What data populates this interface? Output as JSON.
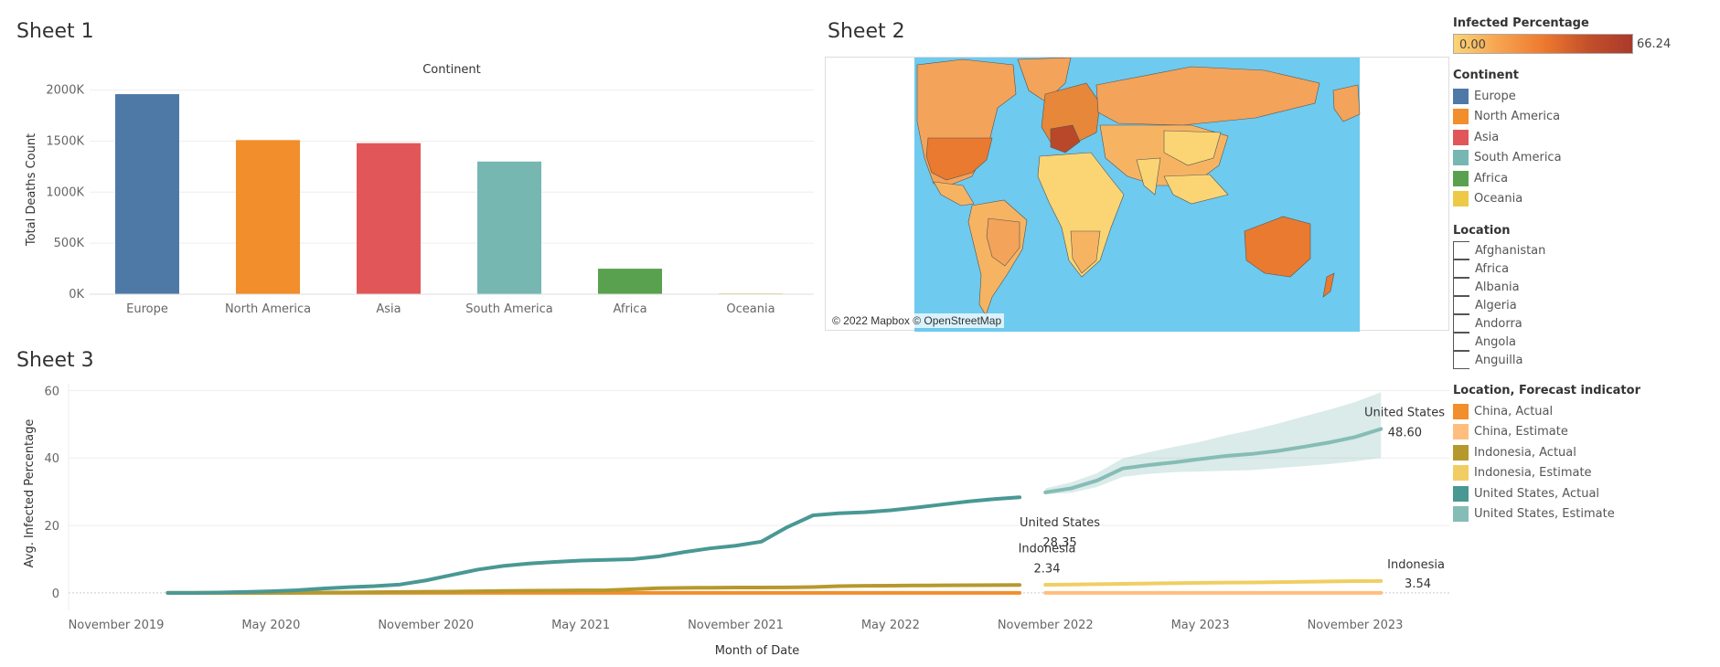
{
  "sheets": {
    "sheet1_title": "Sheet 1",
    "sheet2_title": "Sheet 2",
    "sheet3_title": "Sheet 3"
  },
  "map": {
    "attribution": "© 2022 Mapbox © OpenStreetMap",
    "ocean_color": "#6ecaee"
  },
  "legends": {
    "infected_title": "Infected Percentage",
    "infected_min": "0.00",
    "infected_max": "66.24",
    "continent_title": "Continent",
    "continents": [
      {
        "label": "Europe",
        "color": "#4e79a7"
      },
      {
        "label": "North America",
        "color": "#f28e2b"
      },
      {
        "label": "Asia",
        "color": "#e15759"
      },
      {
        "label": "South America",
        "color": "#76b7b2"
      },
      {
        "label": "Africa",
        "color": "#59a14f"
      },
      {
        "label": "Oceania",
        "color": "#edc948"
      }
    ],
    "location_title": "Location",
    "locations": [
      "Afghanistan",
      "Africa",
      "Albania",
      "Algeria",
      "Andorra",
      "Angola",
      "Anguilla"
    ],
    "forecast_title": "Location, Forecast indicator",
    "forecast_items": [
      {
        "label": "China, Actual",
        "color": "#f28e2b"
      },
      {
        "label": "China, Estimate",
        "color": "#ffbe7d"
      },
      {
        "label": "Indonesia, Actual",
        "color": "#b6992d"
      },
      {
        "label": "Indonesia, Estimate",
        "color": "#f1ce63"
      },
      {
        "label": "United States, Actual",
        "color": "#499894"
      },
      {
        "label": "United States, Estimate",
        "color": "#86bcb6"
      }
    ]
  },
  "chart_data": [
    {
      "type": "bar",
      "title": "Continent",
      "ylabel": "Total Deaths Count",
      "xlabel": "",
      "categories": [
        "Europe",
        "North America",
        "Asia",
        "South America",
        "Africa",
        "Oceania"
      ],
      "values": [
        1960000,
        1510000,
        1480000,
        1300000,
        250000,
        8000
      ],
      "colors": [
        "#4e79a7",
        "#f28e2b",
        "#e15759",
        "#76b7b2",
        "#59a14f",
        "#edc948"
      ],
      "yticks": [
        0,
        500000,
        1000000,
        1500000,
        2000000
      ],
      "ytick_labels": [
        "0K",
        "500K",
        "1000K",
        "1500K",
        "2000K"
      ],
      "ylim": [
        0,
        2050000
      ],
      "grid": true
    },
    {
      "type": "line",
      "xlabel": "Month of Date",
      "ylabel": "Avg. Infected Percentage",
      "ylim": [
        -3,
        62
      ],
      "yticks": [
        0,
        20,
        40,
        60
      ],
      "xticks": [
        "November 2019",
        "May 2020",
        "November 2020",
        "May 2021",
        "November 2021",
        "May 2022",
        "November 2022",
        "May 2023",
        "November 2023"
      ],
      "x_months": [
        "2020-01",
        "2020-02",
        "2020-03",
        "2020-04",
        "2020-05",
        "2020-06",
        "2020-07",
        "2020-08",
        "2020-09",
        "2020-10",
        "2020-11",
        "2020-12",
        "2021-01",
        "2021-02",
        "2021-03",
        "2021-04",
        "2021-05",
        "2021-06",
        "2021-07",
        "2021-08",
        "2021-09",
        "2021-10",
        "2021-11",
        "2021-12",
        "2022-01",
        "2022-02",
        "2022-03",
        "2022-04",
        "2022-05",
        "2022-06",
        "2022-07",
        "2022-08",
        "2022-09",
        "2022-10"
      ],
      "forecast_months": [
        "2022-11",
        "2022-12",
        "2023-01",
        "2023-02",
        "2023-03",
        "2023-04",
        "2023-05",
        "2023-06",
        "2023-07",
        "2023-08",
        "2023-09",
        "2023-10",
        "2023-11",
        "2023-12"
      ],
      "series": [
        {
          "name": "United States, Actual",
          "color": "#499894",
          "values": [
            0.0,
            0.0,
            0.1,
            0.3,
            0.5,
            0.8,
            1.3,
            1.7,
            2.0,
            2.5,
            3.7,
            5.3,
            6.9,
            8.0,
            8.7,
            9.2,
            9.6,
            9.8,
            10.0,
            10.8,
            12.1,
            13.2,
            14.0,
            15.2,
            19.5,
            23.0,
            23.6,
            23.9,
            24.5,
            25.3,
            26.2,
            27.1,
            27.8,
            28.35
          ]
        },
        {
          "name": "United States, Estimate",
          "color": "#86bcb6",
          "values": [
            29.8,
            31.0,
            33.3,
            36.9,
            37.9,
            38.7,
            39.7,
            40.6,
            41.2,
            42.1,
            43.3,
            44.6,
            46.2,
            48.6
          ],
          "upper": [
            31.0,
            32.8,
            35.5,
            39.9,
            41.7,
            43.3,
            44.8,
            46.7,
            48.3,
            50.2,
            52.3,
            54.3,
            56.6,
            59.5
          ],
          "lower": [
            29.2,
            29.7,
            31.4,
            34.4,
            35.3,
            35.8,
            36.0,
            36.2,
            36.4,
            37.0,
            37.6,
            38.2,
            39.0,
            40.0
          ]
        },
        {
          "name": "Indonesia, Actual",
          "color": "#b6992d",
          "values": [
            0.0,
            0.0,
            0.0,
            0.0,
            0.0,
            0.05,
            0.1,
            0.15,
            0.2,
            0.3,
            0.35,
            0.4,
            0.5,
            0.6,
            0.65,
            0.7,
            0.75,
            0.8,
            1.1,
            1.4,
            1.5,
            1.55,
            1.6,
            1.6,
            1.65,
            1.75,
            2.0,
            2.1,
            2.15,
            2.2,
            2.25,
            2.28,
            2.3,
            2.34
          ]
        },
        {
          "name": "Indonesia, Estimate",
          "color": "#f1ce63",
          "values": [
            2.4,
            2.5,
            2.6,
            2.7,
            2.8,
            2.9,
            3.0,
            3.05,
            3.1,
            3.2,
            3.3,
            3.4,
            3.5,
            3.54
          ]
        },
        {
          "name": "China, Actual",
          "color": "#f28e2b",
          "values": [
            0.0,
            0.0,
            0.0,
            0.0,
            0.0,
            0.0,
            0.0,
            0.0,
            0.0,
            0.0,
            0.0,
            0.0,
            0.0,
            0.0,
            0.0,
            0.0,
            0.0,
            0.0,
            0.0,
            0.0,
            0.0,
            0.0,
            0.0,
            0.0,
            0.0,
            0.0,
            0.0,
            0.0,
            0.0,
            0.0,
            0.0,
            0.0,
            0.0,
            0.0
          ]
        },
        {
          "name": "China, Estimate",
          "color": "#ffbe7d",
          "values": [
            0.0,
            0.0,
            0.0,
            0.0,
            0.0,
            0.0,
            0.0,
            0.0,
            0.0,
            0.0,
            0.0,
            0.0,
            0.0,
            0.0
          ]
        }
      ],
      "annotations": [
        {
          "text": "United States",
          "value": "28.35"
        },
        {
          "text": "Indonesia",
          "value": "2.34"
        },
        {
          "text": "United States",
          "value": "48.60"
        },
        {
          "text": "Indonesia",
          "value": "3.54"
        }
      ],
      "grid": true
    }
  ]
}
